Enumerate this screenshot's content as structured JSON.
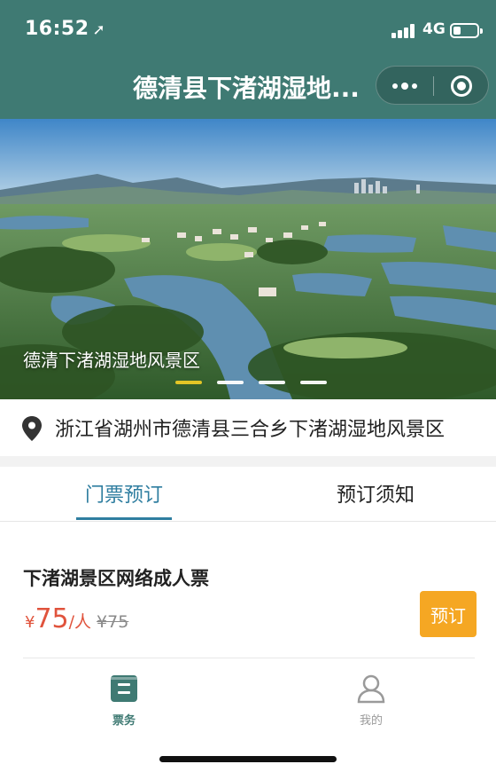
{
  "status_bar": {
    "time": "16:52",
    "network": "4G"
  },
  "header": {
    "title": "德清县下渚湖湿地...",
    "background_color": "#3f7a73"
  },
  "banner": {
    "caption": "德清下渚湖湿地风景区",
    "slide_count": 4,
    "active_slide": 1,
    "active_dot_color": "#e3c526"
  },
  "address": {
    "text": "浙江省湖州市德清县三合乡下渚湖湿地风景区",
    "icon": "location-pin-icon"
  },
  "tabs": {
    "items": [
      {
        "label": "门票预订",
        "active": true
      },
      {
        "label": "预订须知",
        "active": false
      }
    ],
    "active_color": "#2f7ea0"
  },
  "ticket": {
    "name": "下渚湖景区网络成人票",
    "currency_symbol": "¥",
    "price": "75",
    "unit": "/人",
    "original_price": "¥75",
    "book_label": "预订",
    "price_color": "#e0533c",
    "button_color": "#f5a723"
  },
  "tabbar": {
    "items": [
      {
        "label": "票务",
        "icon": "ticket-list-icon",
        "active": true
      },
      {
        "label": "我的",
        "icon": "user-icon",
        "active": false
      }
    ]
  }
}
